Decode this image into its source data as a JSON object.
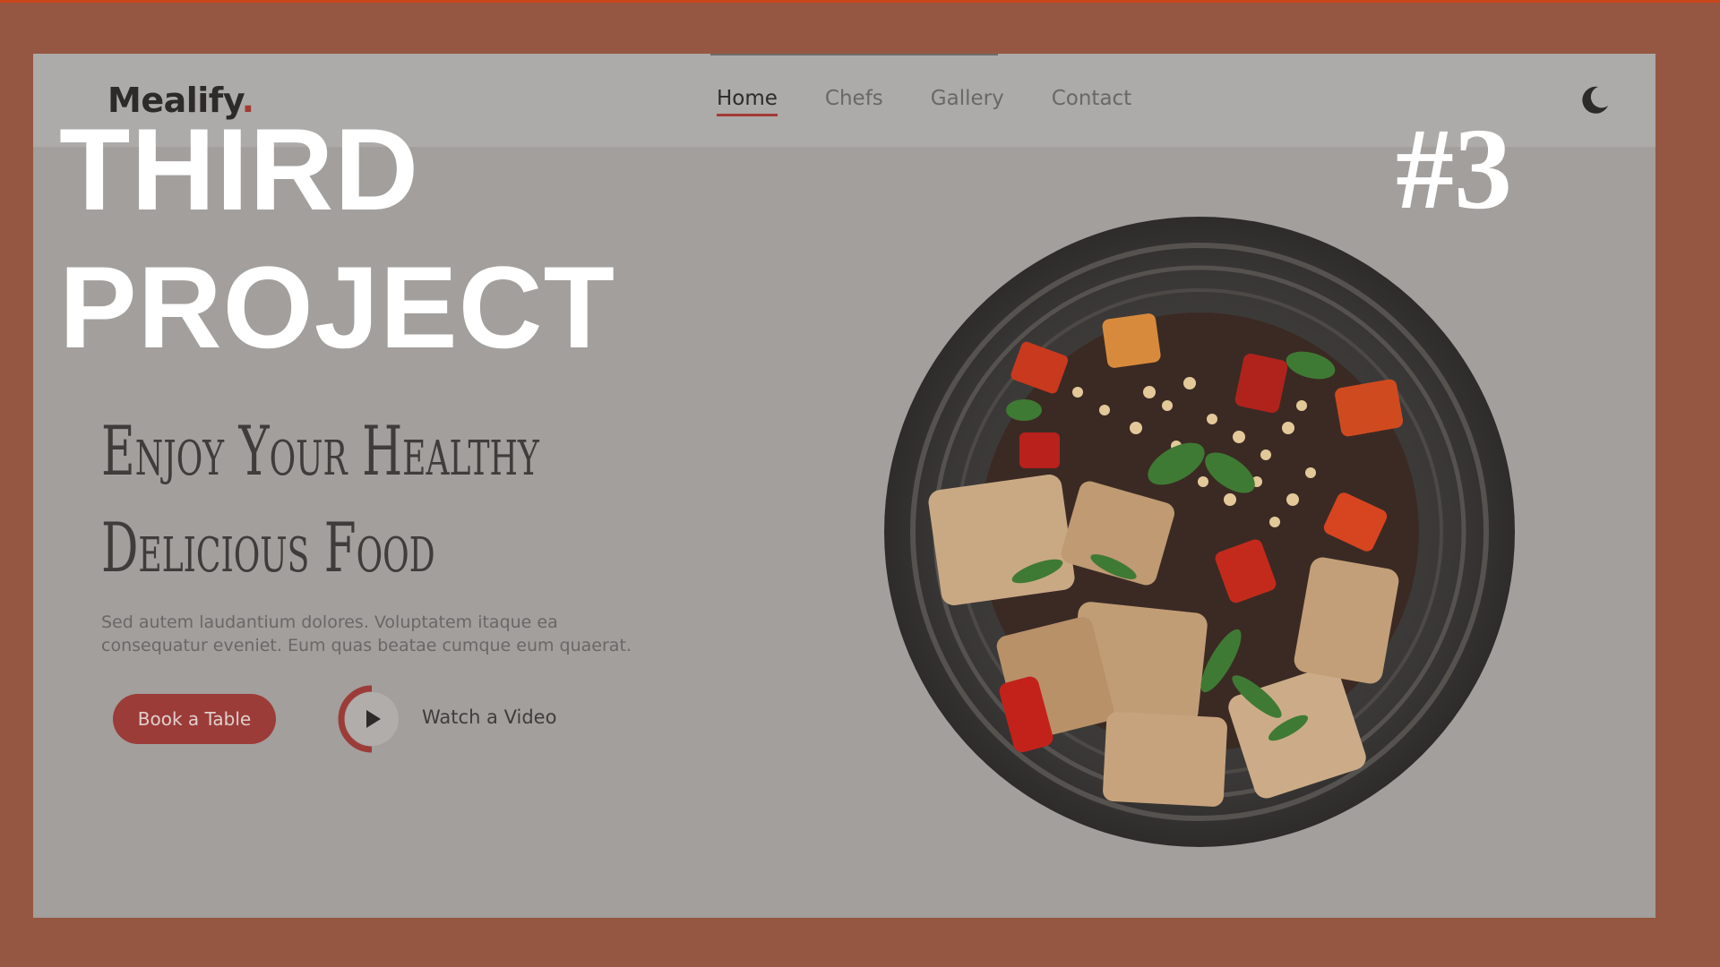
{
  "brand": {
    "name": "Mealify",
    "dot": "."
  },
  "nav": {
    "items": [
      {
        "label": "Home",
        "active": true
      },
      {
        "label": "Chefs",
        "active": false
      },
      {
        "label": "Gallery",
        "active": false
      },
      {
        "label": "Contact",
        "active": false
      }
    ],
    "theme_icon": "moon-icon"
  },
  "hero": {
    "headline_line1": "Enjoy Your Healthy",
    "headline_line2": "Delicious Food",
    "description": "Sed autem laudantium dolores. Voluptatem itaque ea consequatur eveniet. Eum quas beatae cumque eum quaerat.",
    "book_button": "Book a Table",
    "video_label": "Watch a Video",
    "play_icon": "play-icon"
  },
  "overlay": {
    "title_line1": "THIRD",
    "title_line2": "PROJECT",
    "number": "#3"
  },
  "colors": {
    "outer_background": "#955742",
    "page_background": "#a29f9c",
    "accent": "#9b3c39",
    "overlay_text": "#ffffff"
  }
}
